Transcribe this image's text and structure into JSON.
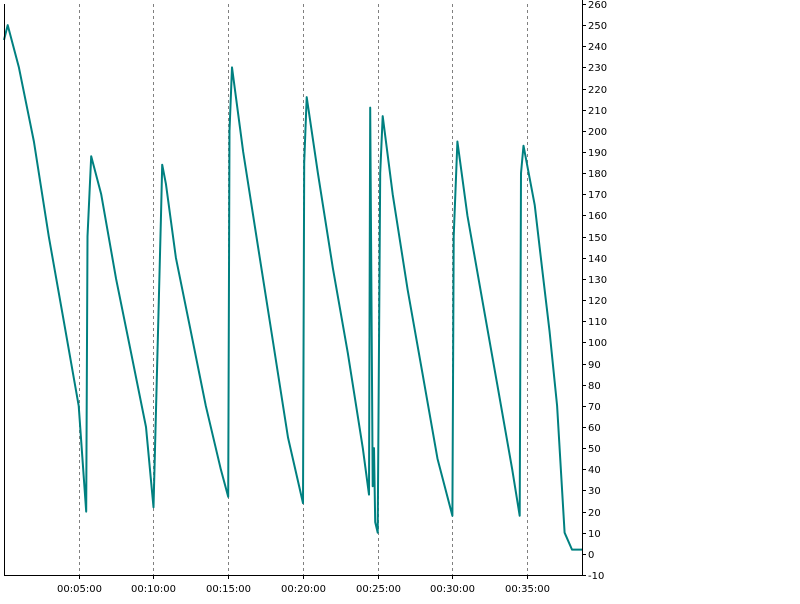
{
  "chart_data": {
    "type": "line",
    "title": "",
    "xlabel": "",
    "ylabel": "",
    "x_ticks": [
      "00:05:00",
      "00:10:00",
      "00:15:00",
      "00:20:00",
      "00:25:00",
      "00:30:00",
      "00:35:00"
    ],
    "xlim": [
      "00:00:00",
      "00:38:40"
    ],
    "y_ticks": [
      -10,
      0,
      10,
      20,
      30,
      40,
      50,
      60,
      70,
      80,
      90,
      100,
      110,
      120,
      130,
      140,
      150,
      160,
      170,
      180,
      190,
      200,
      210,
      220,
      230,
      240,
      250,
      260
    ],
    "ylim": [
      -10,
      260
    ],
    "y_axis_position": "right",
    "grid": "vertical dashed",
    "line_color": "#008080",
    "series": [
      {
        "x": [
          "00:00:00",
          "00:00:15",
          "00:01:00",
          "00:02:00",
          "00:03:00",
          "00:04:00",
          "00:05:00",
          "00:05:30",
          "00:05:35",
          "00:05:50",
          "00:06:30",
          "00:07:30",
          "00:08:30",
          "00:09:30",
          "00:10:00",
          "00:10:30",
          "00:10:35",
          "00:10:50",
          "00:11:30",
          "00:12:30",
          "00:13:30",
          "00:14:30",
          "00:15:00",
          "00:15:05",
          "00:15:15",
          "00:16:00",
          "00:17:00",
          "00:18:00",
          "00:19:00",
          "00:20:00",
          "00:20:05",
          "00:20:15",
          "00:21:00",
          "00:22:00",
          "00:23:00",
          "00:24:00",
          "00:24:25",
          "00:24:30",
          "00:24:40",
          "00:24:45",
          "00:24:50",
          "00:25:00",
          "00:25:10",
          "00:25:20",
          "00:26:00",
          "00:27:00",
          "00:28:00",
          "00:29:00",
          "00:30:00",
          "00:30:05",
          "00:30:20",
          "00:31:00",
          "00:32:00",
          "00:33:00",
          "00:34:00",
          "00:34:30",
          "00:34:35",
          "00:34:45",
          "00:35:30",
          "00:36:00",
          "00:36:30",
          "00:37:00",
          "00:37:30",
          "00:38:00",
          "00:38:40"
        ],
        "values": [
          243,
          250,
          230,
          195,
          150,
          110,
          70,
          20,
          150,
          188,
          170,
          130,
          95,
          60,
          22,
          160,
          184,
          175,
          140,
          105,
          70,
          40,
          27,
          200,
          230,
          190,
          145,
          100,
          55,
          24,
          185,
          216,
          180,
          135,
          95,
          50,
          28,
          211,
          32,
          50,
          15,
          10,
          180,
          207,
          170,
          125,
          85,
          45,
          18,
          150,
          195,
          160,
          120,
          80,
          40,
          18,
          180,
          193,
          165,
          135,
          105,
          70,
          10,
          2,
          2
        ]
      }
    ]
  }
}
